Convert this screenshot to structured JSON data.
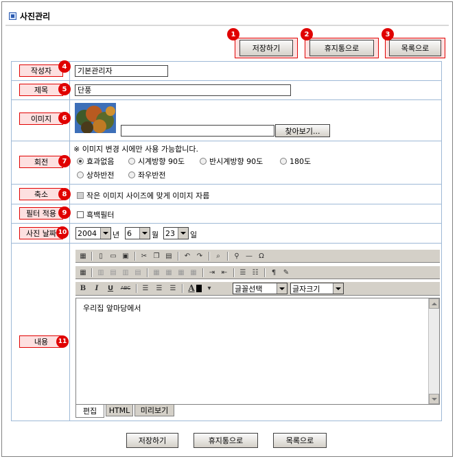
{
  "page": {
    "title": "사진관리"
  },
  "top_buttons": [
    {
      "label": "저장하기",
      "badge": "1"
    },
    {
      "label": "휴지통으로",
      "badge": "2"
    },
    {
      "label": "목록으로",
      "badge": "3"
    }
  ],
  "form": {
    "author": {
      "label": "작성자",
      "badge": "4",
      "value": "기본관리자"
    },
    "subject": {
      "label": "제목",
      "badge": "5",
      "value": "단풍"
    },
    "image": {
      "label": "이미지",
      "badge": "6",
      "file_value": "",
      "browse_label": "찾아보기..."
    },
    "rotate": {
      "label": "회전",
      "badge": "7",
      "note": "※ 이미지 변경 시에만 사용 가능합니다.",
      "options": [
        "효과없음",
        "시계방향 90도",
        "반시계방향 90도",
        "180도",
        "상하반전",
        "좌우반전"
      ],
      "selected": "효과없음"
    },
    "shrink": {
      "label": "축소",
      "badge": "8",
      "checkbox_label": "작은 이미지 사이즈에 맞게 이미지 자름",
      "checked": false
    },
    "filter": {
      "label": "필터 적용",
      "badge": "9",
      "checkbox_label": "흑백필터",
      "checked": false
    },
    "date": {
      "label": "사진 날짜",
      "badge": "10",
      "year": "2004",
      "year_unit": "년",
      "month": "6",
      "month_unit": "월",
      "day": "23",
      "day_unit": "일"
    },
    "content": {
      "label": "내용",
      "badge": "11",
      "font_select": "글꼴선택",
      "size_select": "글자크기",
      "body_text": "우리집 앞마당에서",
      "toolbar_bold": "B",
      "toolbar_italic": "I",
      "toolbar_underline": "U",
      "toolbar_strike": "ABC",
      "toolbar_font_color": "A",
      "tabs": [
        "편집",
        "HTML",
        "미리보기"
      ],
      "active_tab": "편집"
    }
  },
  "bottom_buttons": [
    "저장하기",
    "휴지통으로",
    "목록으로"
  ],
  "colors": {
    "accent_red": "#e00000",
    "highlight_bg": "#fde0e0",
    "border_blue": "#9db8d6"
  }
}
